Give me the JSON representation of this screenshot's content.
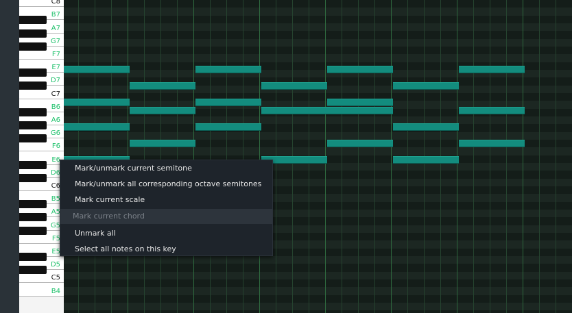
{
  "piano_keys": {
    "labels": [
      "C8",
      "B7",
      "A7",
      "G7",
      "F7",
      "E7",
      "D7",
      "C7",
      "B6",
      "A6",
      "G6",
      "F6",
      "E6",
      "D6",
      "C6",
      "B5",
      "A5",
      "G5",
      "F5",
      "E5",
      "D5",
      "C5",
      "B4"
    ]
  },
  "context_menu": {
    "items": [
      {
        "label": "Mark/unmark current semitone",
        "enabled": true
      },
      {
        "label": "Mark/unmark all corresponding octave semitones",
        "enabled": true
      },
      {
        "label": "Mark current scale",
        "enabled": true
      },
      {
        "label": "Mark current chord",
        "enabled": false
      },
      {
        "label": "Unmark all",
        "enabled": true
      },
      {
        "label": "Select all notes on this key",
        "enabled": true
      }
    ]
  },
  "colors": {
    "note": "#138c7e",
    "key_label_natural": "#1fc16b",
    "key_label_c": "#111111",
    "menu_bg": "#1e242b"
  }
}
